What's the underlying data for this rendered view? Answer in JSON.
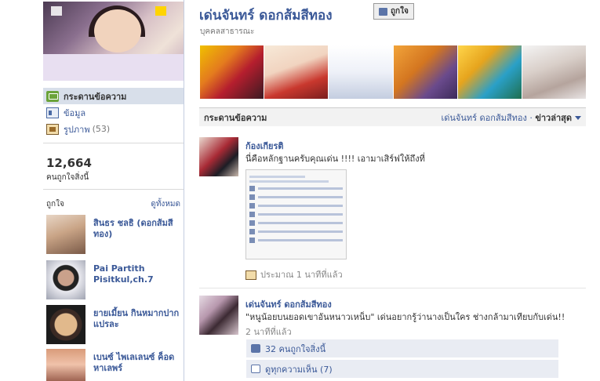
{
  "page": {
    "title": "เด่นจันทร์ ดอกส้มสีทอง",
    "like_button": "ถูกใจ",
    "category": "บุคคลสาธารณะ"
  },
  "nav": {
    "items": [
      {
        "label": "กระดานข้อความ",
        "count": ""
      },
      {
        "label": "ข้อมูล",
        "count": ""
      },
      {
        "label": "รูปภาพ",
        "count": "(53)"
      }
    ]
  },
  "likes": {
    "count": "12,664",
    "label": "คนถูกใจสิ่งนี้",
    "section_title": "ถูกใจ",
    "see_all": "ดูทั้งหมด",
    "fans": [
      {
        "name": "สินธร ชลธิ (ดอกส้มสีทอง)"
      },
      {
        "name": "Pai Partith Pisitkul,ch.7"
      },
      {
        "name": "ยายเมี้ยน กินหมากปากแปรละ"
      },
      {
        "name": "เบนซ์ ไพเลเลนซ์ ค็อด หาเลพร์"
      }
    ]
  },
  "wall": {
    "title": "กระดานข้อความ",
    "filter_name": "เด่นจันทร์ ดอกส้มสีทอง",
    "filter_sep": " · ",
    "filter_value": "ข่าวล่าสุด"
  },
  "posts": [
    {
      "author": "ก้องเกียรติ",
      "message": "นี่คือหลักฐานครับคุณเด่น !!!! เอามาเสิร์ฟให้ถึงที่",
      "time": "ประมาณ 1 นาทีที่แล้ว"
    },
    {
      "author": "เด่นจันทร์ ดอกส้มสีทอง",
      "message": "\"หนูน้อยบนยอดเขาอันหนาวเหน็บ\" เด่นอยากรู้ว่านางเป็นใคร ช่างกล้ามาเทียบกับเด่น!!",
      "time": "2 นาทีที่แล้ว",
      "likes_text": "32 คนถูกใจสิ่งนี้",
      "comments_text": "ดูทุกความเห็น (7)"
    }
  ],
  "colors": {
    "link": "#3b5998",
    "nav_active_bg": "#d8dfea",
    "feedback_bg": "#e9ecf3"
  },
  "icons": [
    "wall-icon",
    "info-icon",
    "photos-icon",
    "like-thumb-icon",
    "comment-icon",
    "photo-attachment-icon"
  ]
}
